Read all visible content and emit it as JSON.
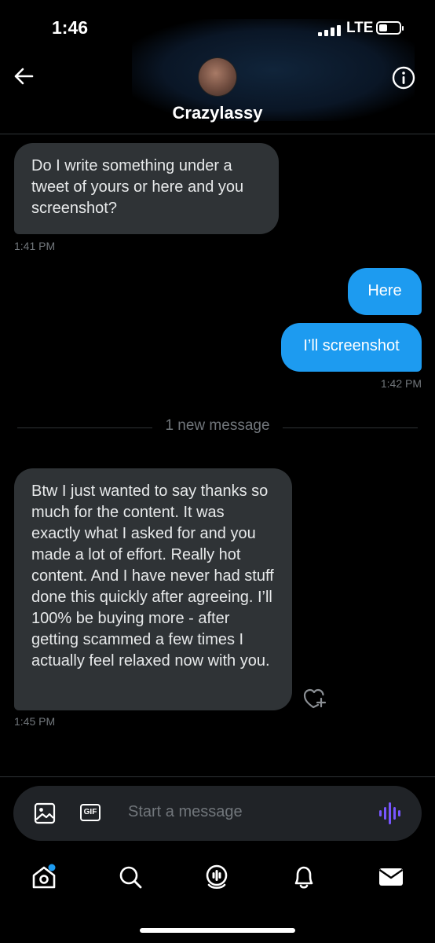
{
  "status_bar": {
    "time": "1:46",
    "network": "LTE"
  },
  "header": {
    "contact_name": "Crazylassy",
    "back_icon": "back-arrow-icon",
    "info_icon": "info-icon"
  },
  "messages": [
    {
      "direction": "incoming",
      "text": "Do I write something under a tweet of yours or here and you screenshot?",
      "time": "1:41 PM"
    },
    {
      "direction": "outgoing",
      "text": "Here"
    },
    {
      "direction": "outgoing",
      "text": "I’ll screenshot",
      "time": "1:42 PM"
    },
    {
      "direction": "incoming",
      "text": "Btw I just wanted to say thanks so much for the content. It was exactly what I asked for and you made a lot of effort. Really hot content. And I have never had stuff done this quickly after agreeing. I’ll 100% be buying more - after getting scammed a few times I actually feel relaxed now with you.",
      "time": "1:45 PM"
    }
  ],
  "divider": {
    "label": "1 new message"
  },
  "composer": {
    "placeholder": "Start a message",
    "image_icon": "image-icon",
    "gif_label": "GIF",
    "voice_icon": "voice-icon"
  },
  "tabs": [
    {
      "name": "home",
      "icon": "home-icon",
      "has_badge": true
    },
    {
      "name": "search",
      "icon": "search-icon"
    },
    {
      "name": "spaces",
      "icon": "spaces-icon"
    },
    {
      "name": "notifications",
      "icon": "bell-icon"
    },
    {
      "name": "messages",
      "icon": "mail-icon"
    }
  ],
  "colors": {
    "accent": "#1d9bf0",
    "incoming_bubble": "#2f3336",
    "background": "#000000",
    "voice_icon": "#7856ff"
  }
}
